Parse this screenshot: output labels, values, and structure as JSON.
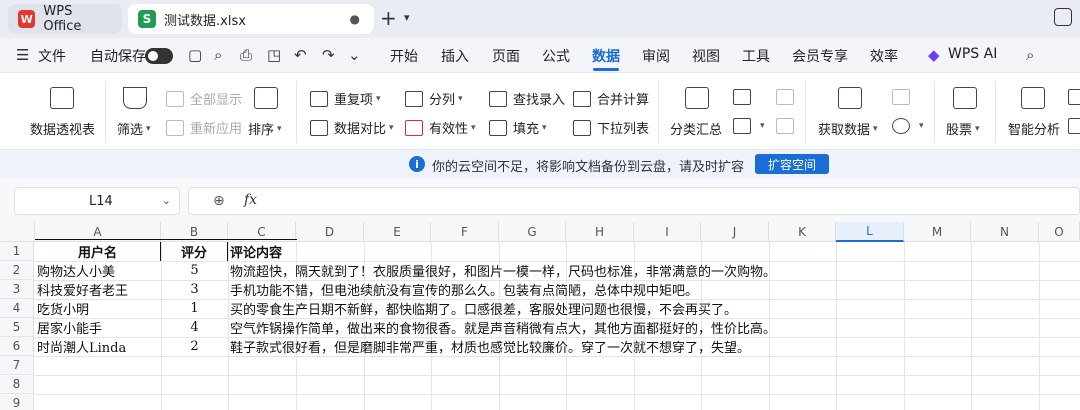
{
  "tabs": {
    "home_label": "WPS Office",
    "home_logo": "W",
    "file_label": "测试数据.xlsx",
    "file_logo": "S",
    "file_dot": "●",
    "new_tab": "+",
    "dropdown": "⌄"
  },
  "menubar": {
    "file": "文件",
    "autosave": "自动保存",
    "items": [
      "开始",
      "插入",
      "页面",
      "公式",
      "数据",
      "审阅",
      "视图",
      "工具",
      "会员专享",
      "效率",
      "WPS AI"
    ],
    "active": "数据",
    "search_icon": "search-icon"
  },
  "ribbon": {
    "pivot": "数据透视表",
    "filter": "筛选",
    "show_all": "全部显示",
    "reapply": "重新应用",
    "sort": "排序",
    "duplicates": "重复项",
    "compare": "数据对比",
    "split": "分列",
    "validity": "有效性",
    "lookup": "查找录入",
    "fill": "填充",
    "consolidate": "合并计算",
    "dropdown_list": "下拉列表",
    "subtotal": "分类汇总",
    "get_data": "获取数据",
    "stock": "股票",
    "smart_analysis": "智能分析"
  },
  "notice": {
    "icon": "i",
    "text": "你的云空间不足，将影响文档备份到云盘，请及时扩容",
    "button": "扩容空间"
  },
  "formula_bar": {
    "name_box": "L14",
    "fx": "fx",
    "formula": ""
  },
  "sheet": {
    "columns": [
      "A",
      "B",
      "C",
      "D",
      "E",
      "F",
      "G",
      "H",
      "I",
      "J",
      "K",
      "L",
      "M",
      "N",
      "O"
    ],
    "selected_column": "L",
    "rows": [
      "1",
      "2",
      "3",
      "4",
      "5",
      "6",
      "7",
      "8",
      "9"
    ],
    "header": [
      "用户名",
      "评分",
      "评论内容"
    ],
    "data": [
      [
        "购物达人小美",
        "5",
        "物流超快，隔天就到了！衣服质量很好，和图片一模一样，尺码也标准，非常满意的一次购物。"
      ],
      [
        "科技爱好者老王",
        "3",
        "手机功能不错，但电池续航没有宣传的那么久。包装有点简陋，总体中规中矩吧。"
      ],
      [
        "吃货小明",
        "1",
        "买的零食生产日期不新鲜，都快临期了。口感很差，客服处理问题也很慢，不会再买了。"
      ],
      [
        "居家小能手",
        "4",
        "空气炸锅操作简单，做出来的食物很香。就是声音稍微有点大，其他方面都挺好的，性价比高。"
      ],
      [
        "时尚潮人Linda",
        "2",
        "鞋子款式很好看，但是磨脚非常严重，材质也感觉比较廉价。穿了一次就不想穿了，失望。"
      ]
    ]
  }
}
